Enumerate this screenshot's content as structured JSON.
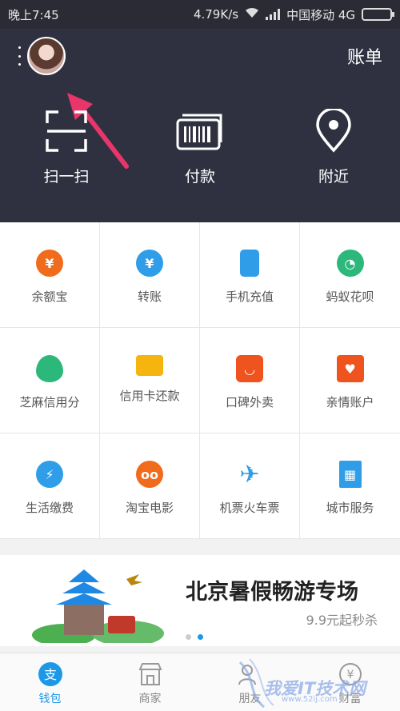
{
  "status_bar": {
    "time": "晚上7:45",
    "speed": "4.79K/s",
    "carrier": "中国移动 4G"
  },
  "header": {
    "bill_label": "账单",
    "actions": [
      {
        "label": "扫一扫",
        "icon": "scan-icon"
      },
      {
        "label": "付款",
        "icon": "barcode-icon"
      },
      {
        "label": "附近",
        "icon": "location-pin-icon"
      }
    ]
  },
  "grid": [
    {
      "label": "余额宝",
      "icon": "money-bag-icon",
      "color": "#f06b1c"
    },
    {
      "label": "转账",
      "icon": "transfer-icon",
      "color": "#2f9de8"
    },
    {
      "label": "手机充值",
      "icon": "phone-icon",
      "color": "#2f9de8"
    },
    {
      "label": "蚂蚁花呗",
      "icon": "huabei-icon",
      "color": "#2cb87a"
    },
    {
      "label": "芝麻信用分",
      "icon": "sesame-icon",
      "color": "#2cb87a"
    },
    {
      "label": "信用卡还款",
      "icon": "credit-card-icon",
      "color": "#f5b40e"
    },
    {
      "label": "口碑外卖",
      "icon": "koubei-icon",
      "color": "#f0541e"
    },
    {
      "label": "亲情账户",
      "icon": "family-house-icon",
      "color": "#f0541e"
    },
    {
      "label": "生活缴费",
      "icon": "utility-drop-icon",
      "color": "#2f9de8"
    },
    {
      "label": "淘宝电影",
      "icon": "movie-glasses-icon",
      "color": "#f06b1c"
    },
    {
      "label": "机票火车票",
      "icon": "airplane-icon",
      "color": "#2f9de8"
    },
    {
      "label": "城市服务",
      "icon": "city-building-icon",
      "color": "#2f9de8"
    }
  ],
  "banner": {
    "title": "北京暑假畅游专场",
    "subtitle": "9.9元起秒杀",
    "page_count": 2,
    "active_page": 2
  },
  "tabs": [
    {
      "label": "钱包",
      "icon": "wallet-icon",
      "active": true
    },
    {
      "label": "商家",
      "icon": "store-icon",
      "active": false
    },
    {
      "label": "朋友",
      "icon": "friends-icon",
      "active": false
    },
    {
      "label": "财富",
      "icon": "wealth-icon",
      "active": false
    }
  ],
  "watermark": {
    "text": "我爱IT技术网",
    "url": "www.52ij.com"
  },
  "colors": {
    "header_bg": "#2f3140",
    "accent": "#1d98e8",
    "arrow": "#e8356a"
  }
}
